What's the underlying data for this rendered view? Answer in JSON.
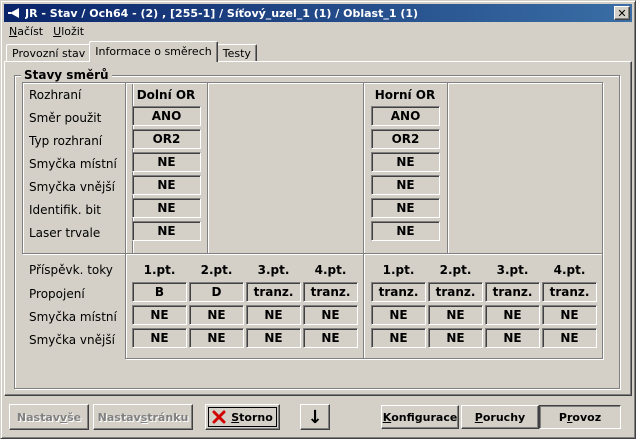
{
  "window": {
    "title": "JR - Stav / Och64 - (2) , [255-1] / Síťový_uzel_1 (1) / Oblast_1 (1)",
    "close_glyph": "✕"
  },
  "menu": [
    {
      "label": "Načíst",
      "accel": "N",
      "rest": "ačíst"
    },
    {
      "label": "Uložit",
      "accel": "U",
      "rest": "ložit"
    }
  ],
  "tabs": [
    {
      "label": "Provozní stav",
      "active": false
    },
    {
      "label": "Informace o směrech",
      "active": true
    },
    {
      "label": "Testy",
      "active": false
    }
  ],
  "group": {
    "title": "Stavy směrů",
    "row_labels": [
      "Rozhraní",
      "Směr použit",
      "Typ rozhraní",
      "Smyčka místní",
      "Smyčka vnější",
      "Identifik. bit",
      "Laser trvale"
    ],
    "left_or": {
      "title": "Dolní OR",
      "values": [
        "ANO",
        "OR2",
        "NE",
        "NE",
        "NE",
        "NE"
      ]
    },
    "right_or": {
      "title": "Horní OR",
      "values": [
        "ANO",
        "OR2",
        "NE",
        "NE",
        "NE",
        "NE"
      ]
    },
    "bottom_labels": [
      "Příspěvk. toky",
      "Propojení",
      "Smyčka místní",
      "Smyčka vnější"
    ],
    "columns_left": [
      "1.pt.",
      "2.pt.",
      "3.pt.",
      "4.pt."
    ],
    "columns_right": [
      "1.pt.",
      "2.pt.",
      "3.pt.",
      "4.pt."
    ],
    "left_grid": [
      [
        "B",
        "D",
        "tranz.",
        "tranz."
      ],
      [
        "NE",
        "NE",
        "NE",
        "NE"
      ],
      [
        "NE",
        "NE",
        "NE",
        "NE"
      ]
    ],
    "right_grid": [
      [
        "tranz.",
        "tranz.",
        "tranz.",
        "tranz."
      ],
      [
        "NE",
        "NE",
        "NE",
        "NE"
      ],
      [
        "NE",
        "NE",
        "NE",
        "NE"
      ]
    ]
  },
  "buttons": {
    "set_all": {
      "pre": "Nastav ",
      "accel": "v",
      "post": "še",
      "disabled": true
    },
    "set_page": {
      "pre": "Nastav ",
      "accel": "s",
      "post": "tránku",
      "disabled": true
    },
    "cancel": {
      "pre": "",
      "accel": "S",
      "post": "torno"
    },
    "down_glyph": "↓",
    "config": {
      "pre": "",
      "accel": "K",
      "post": "onfigurace"
    },
    "faults": {
      "pre": "",
      "accel": "P",
      "post": "oruchy"
    },
    "operation": {
      "pre": "P",
      "accel": "r",
      "post": "ovoz"
    }
  },
  "colors": {
    "titlebar_start": "#0a246a",
    "titlebar_end": "#3a6ea5",
    "face": "#d4d0c8",
    "cancel_x": "#d00000"
  }
}
